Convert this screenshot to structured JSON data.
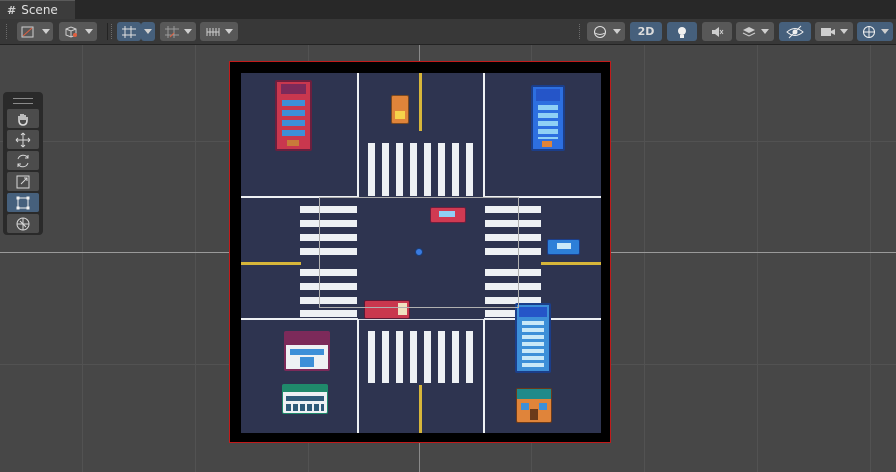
{
  "tab": {
    "label": "Scene"
  },
  "toolbar": {
    "mode_2d_label": "2D"
  },
  "colors": {
    "background": "#464646",
    "active_tool": "#46607c",
    "camera_bounds": "#c21a1a"
  }
}
